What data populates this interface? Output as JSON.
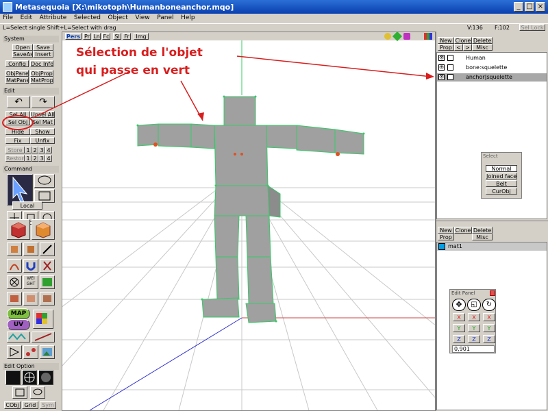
{
  "window": {
    "title": "Metasequoia [X:\\mikotoph\\Humanboneanchor.mqo]"
  },
  "menu": [
    "File",
    "Edit",
    "Attribute",
    "Selected",
    "Object",
    "View",
    "Panel",
    "Help"
  ],
  "status": {
    "hint": "L=Select single  Shift+L=Select with drag",
    "vertices": "V:136",
    "faces": "F:102",
    "sel_lock": "Sel Lock"
  },
  "left": {
    "system_label": "System",
    "open": "Open",
    "save": "Save",
    "saveas": "SaveAs",
    "insert": "Insert",
    "config": "Config",
    "docinfo": "Doc Info",
    "objpanel": "ObjPanel",
    "objprop": "ObjProp",
    "matpanel": "MatPane",
    "matprop": "MatProp",
    "edit_label": "Edit",
    "selall": "Sel All",
    "unselall": "Unsel All",
    "selobj": "Sel Obj",
    "selmat": "Sel Mat",
    "hide": "Hide",
    "show": "Show",
    "fix": "Fix",
    "unfix": "Unfix",
    "store": "Store",
    "restore": "Restore",
    "n1": "1",
    "n2": "2",
    "n3": "3",
    "n4": "4",
    "command_label": "Command",
    "local": "Local",
    "map": "MAP",
    "uv": "UV",
    "weight": "WEI GHT",
    "editoption_label": "Edit Option",
    "cobj": "CObj",
    "grid": "Grid",
    "sym": "Sym"
  },
  "view_tabs": [
    "Pers",
    "Pr",
    "Ln",
    "Fc",
    "Sl",
    "Fr",
    "Img"
  ],
  "annotation": {
    "line1": "Sélection de l'objet",
    "line2": "qui passe en vert"
  },
  "objects_panel": {
    "new": "New",
    "clone": "Clone",
    "delete": "Delete",
    "prop": "Prop",
    "lt": "<",
    "gt": ">",
    "misc": "Misc",
    "items": [
      {
        "name": "Human",
        "selected": false
      },
      {
        "name": "bone:squelette",
        "selected": false
      },
      {
        "name": "anchor|squelette",
        "selected": true
      }
    ]
  },
  "select_panel": {
    "title": "Select",
    "normal": "Normal",
    "joined": "Joined face",
    "belt": "Belt",
    "curobj": "CurObj"
  },
  "material_panel": {
    "new": "New",
    "clone": "Clone",
    "delete": "Delete",
    "prop": "Prop",
    "misc": "Misc",
    "items": [
      {
        "name": "mat1",
        "color": "#00a0e8"
      }
    ]
  },
  "edit_panel": {
    "title": "Edit Panel",
    "x": "X",
    "y": "Y",
    "z": "Z",
    "value": "0,901"
  },
  "colors": {
    "title_blue": "#0a3fb0",
    "mesh_gray": "#a0a0a0",
    "sel_green": "#33cc66",
    "annot_red": "#d81e1e"
  }
}
